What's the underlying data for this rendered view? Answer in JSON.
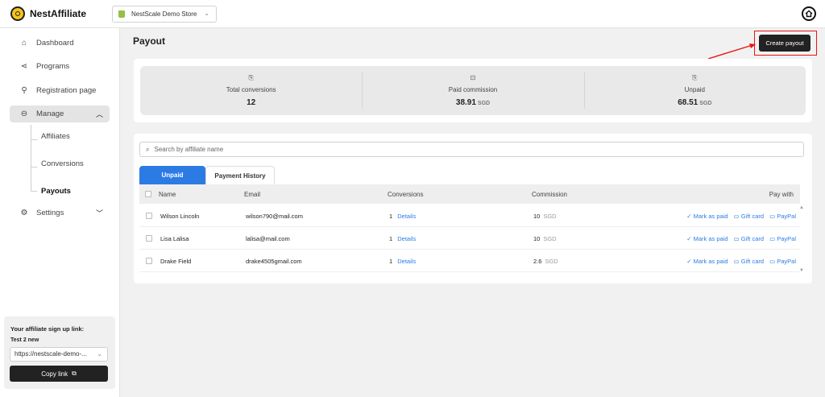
{
  "app": {
    "name": "NestAffiliate",
    "store": "NestScale Demo Store"
  },
  "sidebar": {
    "items": [
      {
        "label": "Dashboard",
        "icon": "home-icon"
      },
      {
        "label": "Programs",
        "icon": "share-icon"
      },
      {
        "label": "Registration page",
        "icon": "user-plus-icon"
      },
      {
        "label": "Manage",
        "icon": "toggle-icon"
      },
      {
        "label": "Settings",
        "icon": "gear-icon"
      }
    ],
    "sub_items": [
      "Affiliates",
      "Conversions",
      "Payouts"
    ]
  },
  "signup": {
    "title": "Your affiliate sign up link:",
    "program": "Test 2 new",
    "link": "https://nestscale-demo-...",
    "copy_label": "Copy link"
  },
  "page": {
    "title": "Payout",
    "create_label": "Create payout"
  },
  "stats": [
    {
      "label": "Total conversions",
      "value": "12",
      "unit": ""
    },
    {
      "label": "Paid commission",
      "value": "38.91",
      "unit": "SGD"
    },
    {
      "label": "Unpaid",
      "value": "68.51",
      "unit": "SGD"
    }
  ],
  "search": {
    "placeholder": "Search by affiliate name"
  },
  "tabs": [
    "Unpaid",
    "Payment History"
  ],
  "table": {
    "columns": [
      "Name",
      "Email",
      "Conversions",
      "Commission",
      "Pay with"
    ],
    "rows": [
      {
        "name": "Wilson Lincoln",
        "email": "wilson790@mail.com",
        "conversions": "1",
        "details": "Details",
        "commission": "10",
        "unit": "SGD"
      },
      {
        "name": "Lisa Lalisa",
        "email": "lalisa@mail.com",
        "conversions": "1",
        "details": "Details",
        "commission": "10",
        "unit": "SGD"
      },
      {
        "name": "Drake Field",
        "email": "drake4505gmail.com",
        "conversions": "1",
        "details": "Details",
        "commission": "2.6",
        "unit": "SGD"
      }
    ],
    "actions": {
      "mark_paid": "✓ Mark as paid",
      "gift_card": "Gift card",
      "paypal": "PayPal"
    }
  },
  "colors": {
    "accent": "#2c7be5",
    "highlight": "#ee1111",
    "dark": "#222222"
  }
}
